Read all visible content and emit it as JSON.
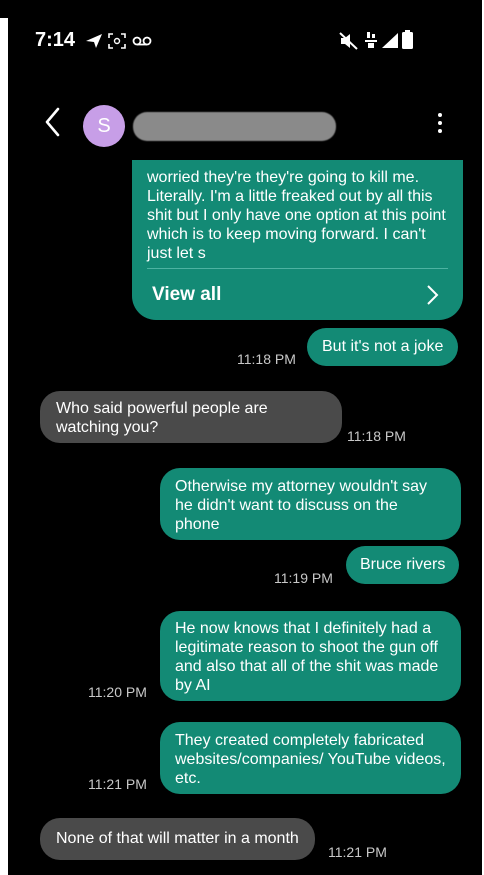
{
  "status_bar": {
    "time": "7:14",
    "icons": [
      "send-icon",
      "screenshot-icon",
      "voicemail-icon",
      "mute-icon",
      "wifi-calling-icon",
      "signal-icon",
      "battery-icon"
    ]
  },
  "header": {
    "back_icon": "chevron-left-icon",
    "avatar_initial": "S",
    "avatar_color": "#c79ee7",
    "contact_name": "",
    "more_icon": "more-vertical-icon"
  },
  "messages": [
    {
      "direction": "outgoing",
      "text": "worried they're they're going to kill me. Literally. I'm a little freaked out by all this shit but I only have one option at this point which is to keep moving forward. I can't just let s",
      "action": "View all"
    },
    {
      "direction": "outgoing",
      "text": "But it's not a joke",
      "time": "11:18 PM"
    },
    {
      "direction": "incoming",
      "text": "Who said powerful people are watching you?",
      "time": "11:18 PM"
    },
    {
      "direction": "outgoing",
      "text": "Otherwise my attorney wouldn't say he didn't want to discuss on the phone",
      "time": ""
    },
    {
      "direction": "outgoing",
      "text": "Bruce rivers",
      "time": "11:19 PM"
    },
    {
      "direction": "outgoing",
      "text": "He now knows that I definitely had a legitimate reason to shoot the gun off and also that all of the shit was made by AI",
      "time": "11:20 PM"
    },
    {
      "direction": "outgoing",
      "text": "They created completely fabricated websites/companies/ YouTube videos,  etc.",
      "time": "11:21 PM"
    },
    {
      "direction": "incoming",
      "text": "None of that will matter in a month",
      "time": "11:21 PM"
    }
  ],
  "colors": {
    "outgoing_bubble": "#138a75",
    "incoming_bubble": "#4a4a4a",
    "background": "#000000"
  }
}
